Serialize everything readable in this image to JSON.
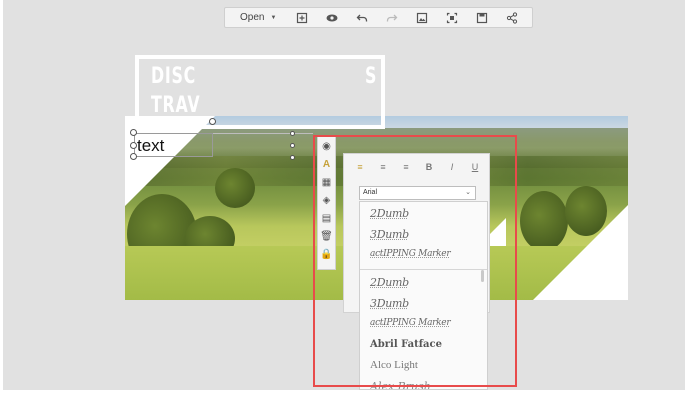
{
  "toolbar": {
    "open_label": "Open",
    "icons": [
      "add-page-icon",
      "preview-eye-icon",
      "undo-icon",
      "redo-icon",
      "image-icon",
      "crop-icon",
      "save-icon",
      "share-icon"
    ]
  },
  "canvas": {
    "text_element": "text",
    "title_line1": "DISC",
    "title_line2": "TRAV",
    "title_line1_right": "S"
  },
  "side_tools": [
    "circle-fill-icon",
    "font-a-icon",
    "pattern-icon",
    "layers-icon",
    "document-icon",
    "trash-icon",
    "lock-icon"
  ],
  "format_panel": {
    "buttons": [
      "≡",
      "≡",
      "≡",
      "B",
      "I",
      "U"
    ],
    "font_selected": "Arial"
  },
  "font_list": {
    "recent": [
      "2Dumb",
      "3Dumb",
      "actIPPING Marker"
    ],
    "all": [
      "2Dumb",
      "3Dumb",
      "actIPPING Marker",
      "Abril Fatface",
      "Alco Light",
      "Alex Brush"
    ]
  },
  "colors": {
    "highlight": "#e84b4b",
    "accent_align": "#c6a23a"
  }
}
